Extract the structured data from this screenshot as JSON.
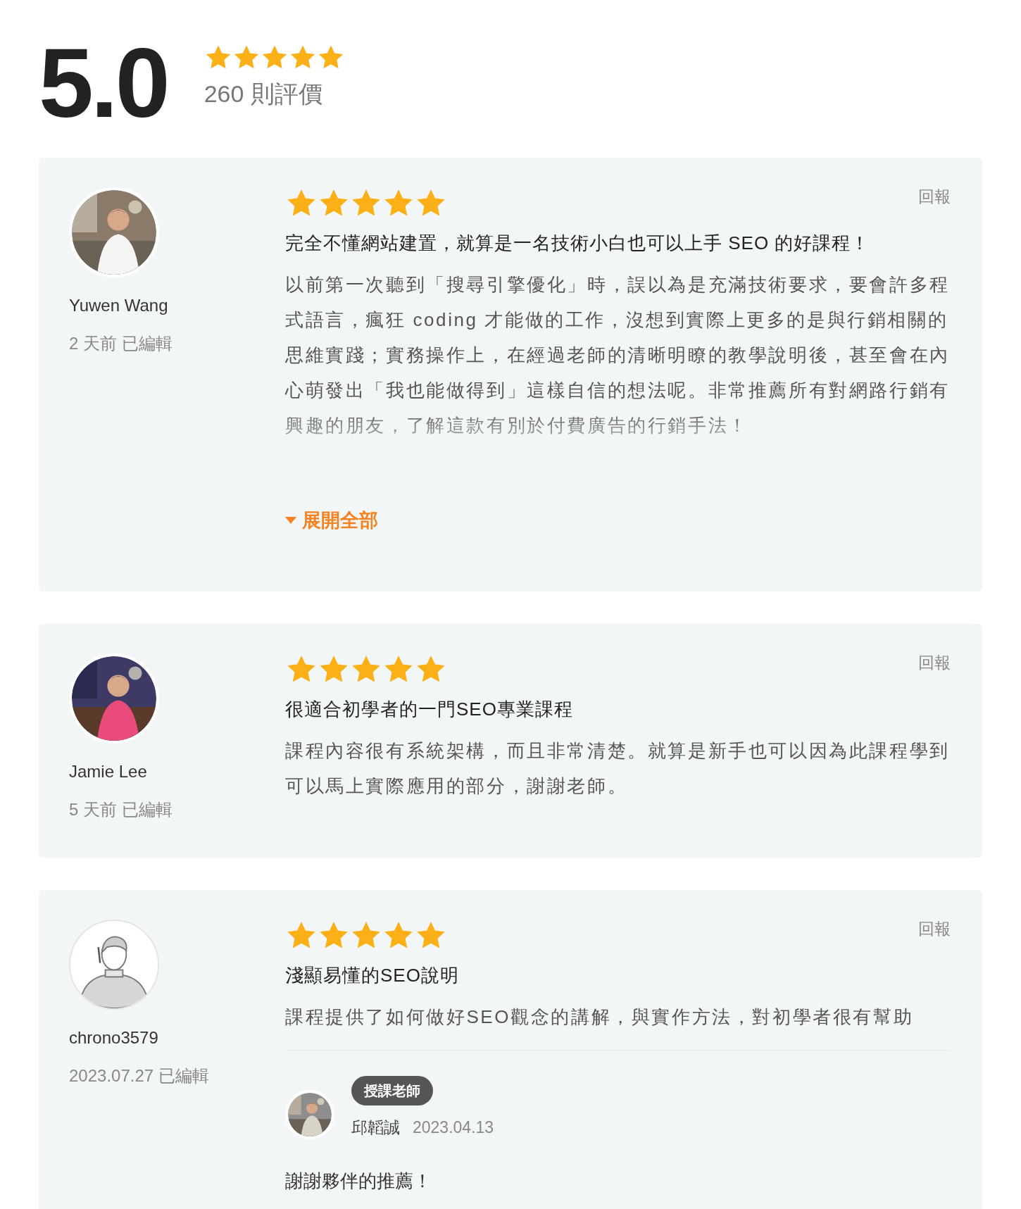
{
  "summary": {
    "score": "5.0",
    "stars": 5,
    "count": "260 則評價"
  },
  "reviews": [
    {
      "name": "Yuwen Wang",
      "meta": "2 天前 已編輯",
      "stars": 5,
      "report": "回報",
      "title": "完全不懂網站建置，就算是一名技術小白也可以上手 SEO 的好課程！",
      "body": "以前第一次聽到「搜尋引擎優化」時，誤以為是充滿技術要求，要會許多程式語言，瘋狂 coding 才能做的工作，沒想到實際上更多的是與行銷相關的思維實踐；實務操作上，在經過老師的清晰明瞭的教學說明後，甚至會在內心萌發出「我也能做得到」這樣自信的想法呢。非常推薦所有對網路行銷有興趣的朋友，了解這款有別於付費廣告的行銷手法！",
      "expanded": false,
      "toggle": "展開全部"
    },
    {
      "name": "Jamie Lee",
      "meta": "5 天前 已編輯",
      "stars": 5,
      "report": "回報",
      "title": "很適合初學者的一門SEO專業課程",
      "body": "課程內容很有系統架構，而且非常清楚。就算是新手也可以因為此課程學到可以馬上實際應用的部分，謝謝老師。"
    },
    {
      "avatar": {
        "kind": "default"
      },
      "name": "chrono3579",
      "meta": "2023.07.27 已編輯",
      "stars": 5,
      "report": "回報",
      "title": "淺顯易懂的SEO說明",
      "body": "課程提供了如何做好SEO觀念的講解，與實作方法，對初學者很有幫助",
      "reply": {
        "badge": "授課老師",
        "name": "邱韜誠",
        "date": "2023.04.13",
        "body": "謝謝夥伴的推薦！"
      }
    }
  ]
}
